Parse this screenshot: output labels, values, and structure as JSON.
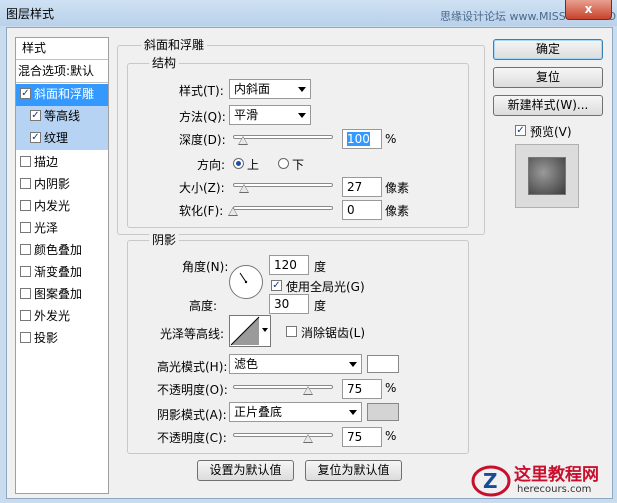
{
  "window": {
    "title": "图层样式",
    "watermark": "思缘设计论坛 www.MISSYUAN.COM",
    "close_label": "x"
  },
  "sidebar": {
    "header": "样式",
    "blend_options": "混合选项:默认",
    "items": [
      {
        "label": "斜面和浮雕",
        "checked": true
      },
      {
        "label": "等高线",
        "checked": true
      },
      {
        "label": "纹理",
        "checked": true
      },
      {
        "label": "描边",
        "checked": false
      },
      {
        "label": "内阴影",
        "checked": false
      },
      {
        "label": "内发光",
        "checked": false
      },
      {
        "label": "光泽",
        "checked": false
      },
      {
        "label": "颜色叠加",
        "checked": false
      },
      {
        "label": "渐变叠加",
        "checked": false
      },
      {
        "label": "图案叠加",
        "checked": false
      },
      {
        "label": "外发光",
        "checked": false
      },
      {
        "label": "投影",
        "checked": false
      }
    ]
  },
  "bevel": {
    "section_title": "斜面和浮雕",
    "structure_title": "结构",
    "style_label": "样式(T):",
    "style_value": "内斜面",
    "technique_label": "方法(Q):",
    "technique_value": "平滑",
    "depth_label": "深度(D):",
    "depth_value": "100",
    "depth_fraction": 0.1,
    "depth_unit": "%",
    "direction_label": "方向:",
    "direction_up": "上",
    "direction_down": "下",
    "direction_selected": "上",
    "size_label": "大小(Z):",
    "size_value": "27",
    "size_fraction": 0.11,
    "size_unit": "像素",
    "soften_label": "软化(F):",
    "soften_value": "0",
    "soften_fraction": 0.0,
    "soften_unit": "像素"
  },
  "shading": {
    "title": "阴影",
    "angle_label": "角度(N):",
    "angle_value": "120",
    "angle_unit": "度",
    "global_light_label": "使用全局光(G)",
    "global_light_checked": true,
    "altitude_label": "高度:",
    "altitude_value": "30",
    "altitude_unit": "度",
    "gloss_contour_label": "光泽等高线:",
    "antialiased_label": "消除锯齿(L)",
    "antialiased_checked": false,
    "highlight_mode_label": "高光模式(H):",
    "highlight_mode_value": "滤色",
    "highlight_color": "#ffffff",
    "highlight_opacity_label": "不透明度(O):",
    "highlight_opacity_value": "75",
    "highlight_opacity_fraction": 0.75,
    "opacity_unit": "%",
    "shadow_mode_label": "阴影模式(A):",
    "shadow_mode_value": "正片叠底",
    "shadow_color": "#d4d4d4",
    "shadow_opacity_label": "不透明度(C):",
    "shadow_opacity_value": "75",
    "shadow_opacity_fraction": 0.75
  },
  "footer": {
    "make_default": "设置为默认值",
    "reset_default": "复位为默认值"
  },
  "actions": {
    "ok": "确定",
    "reset": "复位",
    "new_style": "新建样式(W)...",
    "preview_label": "预览(V)",
    "preview_checked": true
  },
  "logo": {
    "text": "这里教程网",
    "url": "herecours.com"
  }
}
